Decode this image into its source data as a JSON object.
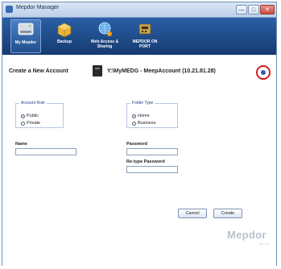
{
  "window": {
    "title": "Mepdor Manager",
    "minimize": "—",
    "maximize": "□",
    "close": "✕"
  },
  "toolbar": {
    "items": [
      {
        "label": "My Mepdor",
        "icon": "hard-drive-icon",
        "active": true
      },
      {
        "label": "Backup",
        "icon": "backup-box-icon",
        "active": false
      },
      {
        "label": "Web Access & Sharing",
        "icon": "globe-share-icon",
        "active": false
      },
      {
        "label": "MEPDOR ON PORT",
        "icon": "network-device-icon",
        "active": false
      }
    ]
  },
  "header": {
    "title": "Create a New Account",
    "device": "Y:\\MyMEDG - MeepAccount (10.21.81.28)",
    "help_icon": "help-icon"
  },
  "form": {
    "account_role": {
      "legend": "Account Role",
      "options": [
        "Public",
        "Private"
      ],
      "selected": "Public"
    },
    "folder_type": {
      "legend": "Folder Type",
      "options": [
        "Home",
        "Business"
      ],
      "selected": "Home"
    },
    "name": {
      "label": "Name",
      "value": ""
    },
    "password": {
      "label": "Password",
      "value": ""
    },
    "retype_password": {
      "label": "Re-type Password",
      "value": ""
    }
  },
  "buttons": {
    "cancel": "Cancel",
    "create": "Create"
  },
  "brand": {
    "logo": "Mepdor",
    "sub": "ver 1.0"
  },
  "colors": {
    "toolbar": "#1d4a8a",
    "accent": "#2d5cb8",
    "highlight_ring": "#d0211d"
  }
}
